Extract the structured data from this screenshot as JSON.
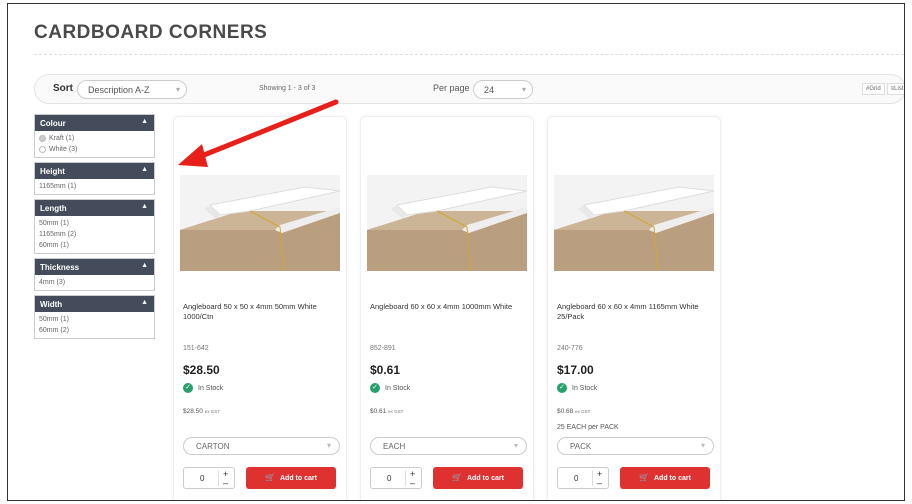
{
  "page": {
    "title": "CARDBOARD CORNERS"
  },
  "toolbar": {
    "sort_label": "Sort",
    "sort_value": "Description A-Z",
    "showing": "Showing 1 - 3 of 3",
    "perpage_label": "Per page",
    "perpage_value": "24",
    "grid_label": "#Grid",
    "list_label": "≡List"
  },
  "filters": [
    {
      "title": "Colour",
      "items": [
        "Kraft (1)",
        "White (3)"
      ],
      "radios": true
    },
    {
      "title": "Height",
      "items": [
        "1165mm (1)"
      ],
      "radios": false
    },
    {
      "title": "Length",
      "items": [
        "50mm (1)",
        "1165mm (2)",
        "60mm (1)"
      ],
      "radios": false
    },
    {
      "title": "Thickness",
      "items": [
        "4mm (3)"
      ],
      "radios": false
    },
    {
      "title": "Width",
      "items": [
        "50mm (1)",
        "60mm (2)"
      ],
      "radios": false
    }
  ],
  "products": [
    {
      "name": "Angleboard 50 x 50 x 4mm 50mm White 1000/Ctn",
      "sku": "151-642",
      "price": "$28.50",
      "stock": "In Stock",
      "unit_price": "$28.50",
      "gst": "ex GST",
      "pack": "",
      "unit_select": "CARTON",
      "qty": "0",
      "add_label": "Add to cart"
    },
    {
      "name": "Angleboard 60 x 60 x 4mm 1000mm White",
      "sku": "852-891",
      "price": "$0.61",
      "stock": "In Stock",
      "unit_price": "$0.61",
      "gst": "ex GST",
      "pack": "",
      "unit_select": "EACH",
      "qty": "0",
      "add_label": "Add to cart"
    },
    {
      "name": "Angleboard 60 x 60 x 4mm 1165mm White 25/Pack",
      "sku": "240-776",
      "price": "$17.00",
      "stock": "In Stock",
      "unit_price": "$0.68",
      "gst": "ex GST",
      "pack": "25 EACH per PACK",
      "unit_select": "PACK",
      "qty": "0",
      "add_label": "Add to cart"
    }
  ],
  "colors": {
    "accent": "#e03131",
    "filter_header": "#444c5c",
    "stock_green": "#27a06c",
    "annotation_arrow": "#e8201a"
  }
}
